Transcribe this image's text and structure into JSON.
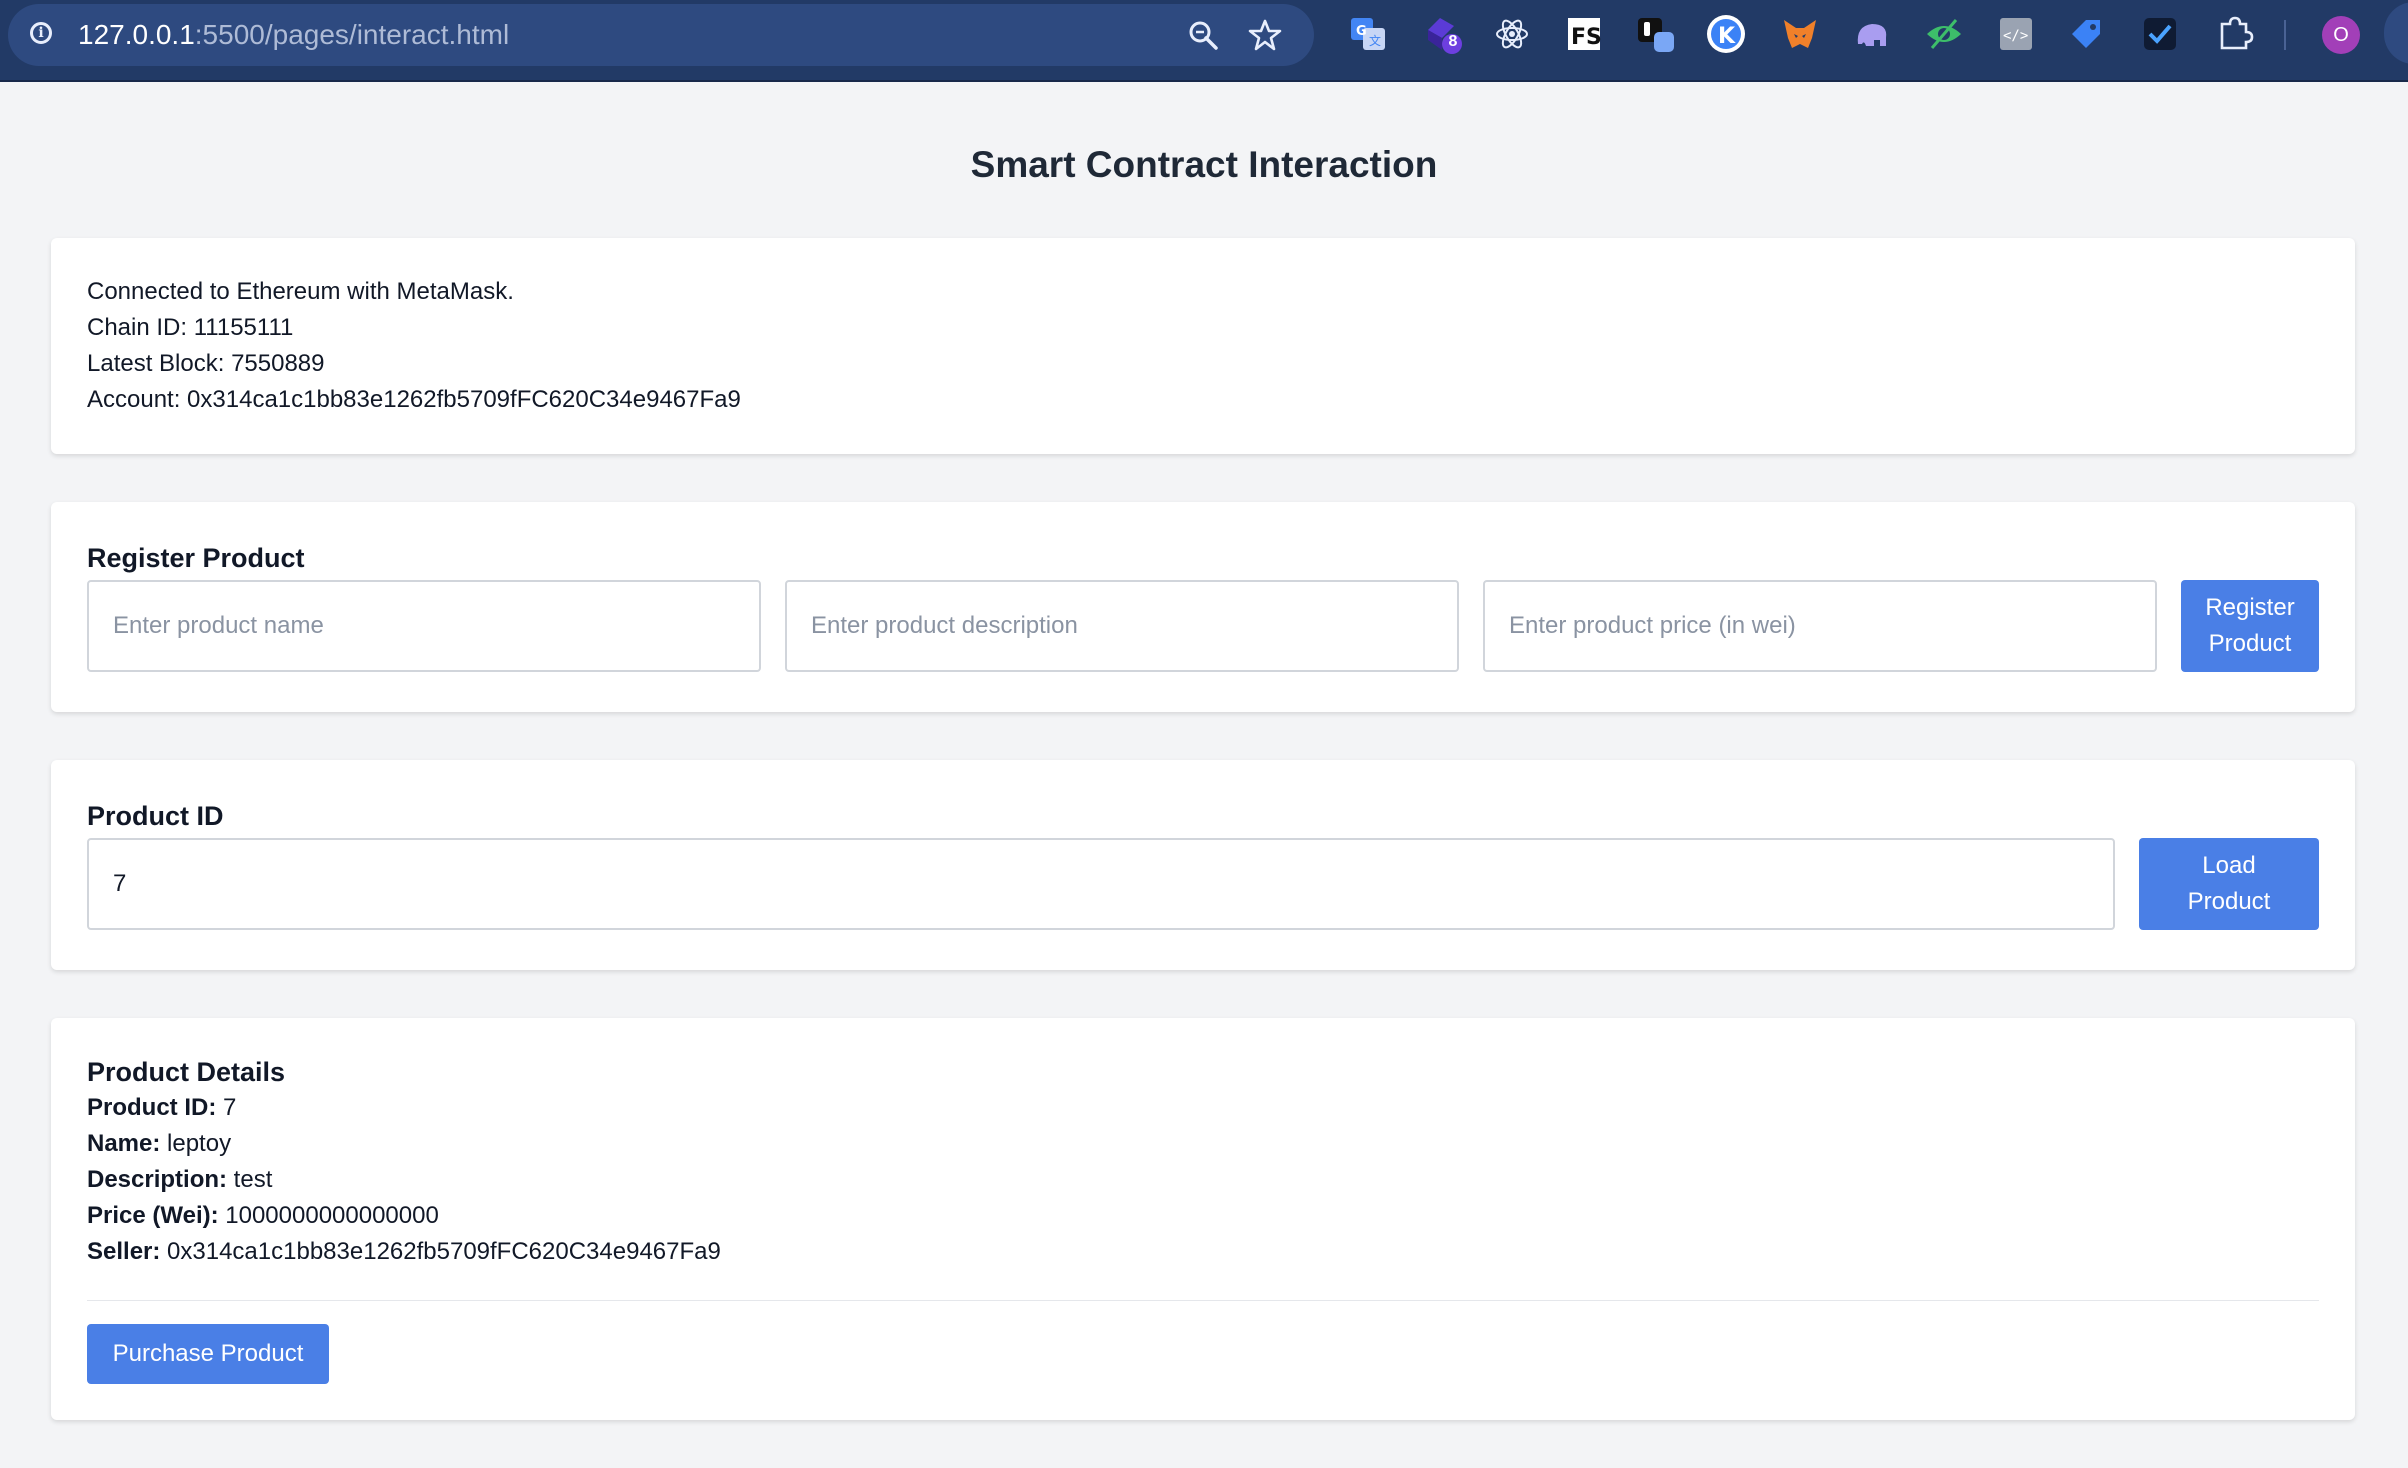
{
  "browser": {
    "url_host": "127.0.0.1",
    "url_rest": ":5500/pages/interact.html",
    "extension_badge_count": "8",
    "profile_initial": "O",
    "extensions": [
      "translate-icon",
      "extension-badge-icon",
      "react-devtools-icon",
      "fs-icon",
      "extension-square-icon",
      "k-icon",
      "metamask-fox-icon",
      "elephant-icon",
      "eye-icon",
      "code-icon",
      "tag-icon",
      "check-icon",
      "puzzle-icon"
    ]
  },
  "page": {
    "title": "Smart Contract Interaction"
  },
  "status": {
    "connected": "Connected to Ethereum with MetaMask.",
    "chain_id": "Chain ID: 11155111",
    "latest_block": "Latest Block: 7550889",
    "account": "Account: 0x314ca1c1bb83e1262fb5709fFC620C34e9467Fa9"
  },
  "register": {
    "heading": "Register Product",
    "name_placeholder": "Enter product name",
    "description_placeholder": "Enter product description",
    "price_placeholder": "Enter product price (in wei)",
    "button_line1": "Register",
    "button_line2": "Product"
  },
  "load": {
    "heading": "Product ID",
    "value": "7",
    "button_line1": "Load",
    "button_line2": "Product"
  },
  "details": {
    "heading": "Product Details",
    "id_label": "Product ID:",
    "id_value": " 7",
    "name_label": "Name:",
    "name_value": " leptoy",
    "description_label": "Description:",
    "description_value": " test",
    "price_label": "Price (Wei):",
    "price_value": " 1000000000000000",
    "seller_label": "Seller:",
    "seller_value": " 0x314ca1c1bb83e1262fb5709fFC620C34e9467Fa9",
    "purchase_button": "Purchase Product"
  },
  "colors": {
    "accent": "#4a7fe6",
    "toolbar": "#223a66",
    "background": "#f3f4f6"
  }
}
